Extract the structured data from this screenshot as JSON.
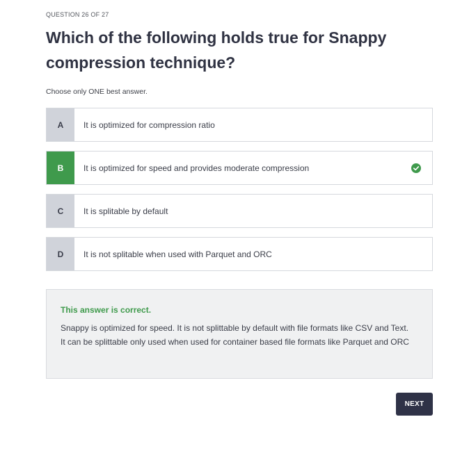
{
  "quiz": {
    "counter": "QUESTION 26 OF 27",
    "question": "Which of the following holds true for Snappy compression technique?",
    "instruction": "Choose only ONE best answer.",
    "options": [
      {
        "letter": "A",
        "text": "It is optimized for compression ratio",
        "correct": false
      },
      {
        "letter": "B",
        "text": "It is optimized for speed and provides moderate compression",
        "correct": true
      },
      {
        "letter": "C",
        "text": "It is splitable by default",
        "correct": false
      },
      {
        "letter": "D",
        "text": "It is not splitable when used with Parquet and ORC",
        "correct": false
      }
    ],
    "feedback": {
      "title": "This answer is correct.",
      "body": "Snappy is optimized for speed. It is not splittable by default with file formats like CSV and Text. It can be splittable only used when used for container based file formats like Parquet and ORC"
    },
    "next_label": "NEXT"
  },
  "colors": {
    "correct": "#3f9a4c",
    "letter_bg": "#d0d3da",
    "button_bg": "#2f3247",
    "feedback_bg": "#f0f1f2"
  },
  "icons": {
    "correct_marker": "check-circle-icon"
  }
}
